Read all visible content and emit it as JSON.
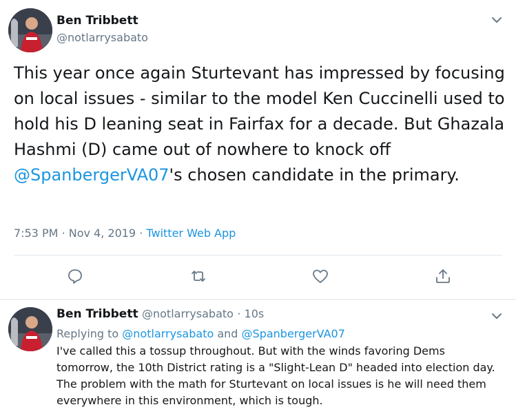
{
  "main_tweet": {
    "author_name": "Ben Tribbett",
    "author_handle": "@notlarrysabato",
    "text_before": "This year once again Sturtevant has impressed by focusing on local issues - similar to the model Ken Cuccinelli used to hold his D leaning seat in Fairfax for a decade.  But Ghazala Hashmi (D) came out of nowhere to knock off ",
    "text_mention": "@SpanbergerVA07",
    "text_after": "'s chosen candidate in the primary.",
    "timestamp": "7:53 PM · Nov 4, 2019",
    "separator": " · ",
    "source": "Twitter Web App",
    "actions": [
      "reply-icon",
      "retweet-icon",
      "like-icon",
      "share-icon"
    ]
  },
  "reply_tweet": {
    "author_name": "Ben Tribbett",
    "author_handle": "@notlarrysabato",
    "time_ago": "· 10s",
    "replying_prefix": "Replying to ",
    "replying_to_1": "@notlarrysabato",
    "replying_and": " and ",
    "replying_to_2": "@SpanbergerVA07",
    "text": "I've called this a tossup throughout.  But with the winds favoring Dems tomorrow, the 10th District rating is a \"Slight-Lean D\" headed into election day.  The problem with the math for Sturtevant on local issues is he will need them everywhere in this environment, which is tough."
  },
  "colors": {
    "accent": "#1b95e0",
    "muted": "#657786",
    "text": "#14171a",
    "border": "#e1e8ed"
  }
}
